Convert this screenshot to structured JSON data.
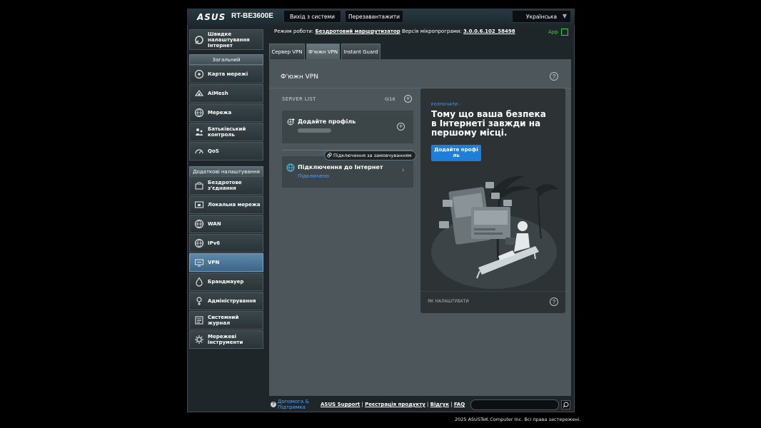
{
  "header": {
    "logo": "ASUS",
    "model": "RT-BE3600E",
    "logout_label": "Вихід з системи",
    "reboot_label": "Перезавантажити",
    "language": "Українська"
  },
  "sidebar": {
    "quick_setup": "Швидке налаштування Інтернет",
    "general_heading": "Загальний",
    "general_items": [
      {
        "label": "Карта мережі",
        "icon": "network-map-icon"
      },
      {
        "label": "AiMesh",
        "icon": "aimesh-icon"
      },
      {
        "label": "Мережа",
        "icon": "globe-icon"
      },
      {
        "label": "Батьківський контроль",
        "icon": "parental-control-icon"
      },
      {
        "label": "QoS",
        "icon": "gauge-icon"
      }
    ],
    "advanced_heading": "Додаткові налаштування",
    "advanced_items": [
      {
        "label": "Бездротове з'єднання",
        "icon": "wifi-icon"
      },
      {
        "label": "Локальна мережа",
        "icon": "lan-icon"
      },
      {
        "label": "WAN",
        "icon": "globe-icon"
      },
      {
        "label": "IPv6",
        "icon": "globe-icon"
      },
      {
        "label": "VPN",
        "icon": "vpn-icon"
      },
      {
        "label": "Брандмауер",
        "icon": "firewall-icon"
      },
      {
        "label": "Адміністрування",
        "icon": "admin-icon"
      },
      {
        "label": "Системний журнал",
        "icon": "log-icon"
      },
      {
        "label": "Мережеві інструменти",
        "icon": "tools-icon"
      }
    ]
  },
  "status": {
    "mode_label": "Режим роботи:",
    "mode_value": "Бездротовий маршрутизатор",
    "fw_label": "Версія мікропрограми:",
    "fw_value": "3.0.0.6.102_58498",
    "app": "App"
  },
  "tabs": [
    "Сервер VPN",
    "Ф'южн VPN",
    "Instant Guard"
  ],
  "panel": {
    "title": "Ф'южн VPN",
    "server_list_title": "SERVER LIST",
    "server_count": "0/16",
    "add_profile": "Додайте профіль",
    "default_badge": "Підключення за замовчуванням",
    "internet_title": "Підключення до Інтернет",
    "internet_status": "Підключено"
  },
  "promo": {
    "kicker": "РОЗПОЧАТИ :",
    "headline": "Тому що ваша безпека в Інтернеті завжди на першому місці.",
    "button": "Додайте профі ль",
    "footer": "ЯК НАЛАШТУВАТИ"
  },
  "footer": {
    "help": "Допомога & Підтримка",
    "links": [
      "ASUS Support",
      "Реєстрація продукту",
      "Відгук",
      "FAQ"
    ],
    "search_value": "",
    "copyright": "2025 ASUSTeK Computer Inc. Всі права застережені."
  },
  "colors": {
    "accent_blue": "#1e7ed8",
    "link_blue": "#4aa3ff",
    "app_green": "#39d339",
    "active_sidebar": "#4a78a0"
  }
}
